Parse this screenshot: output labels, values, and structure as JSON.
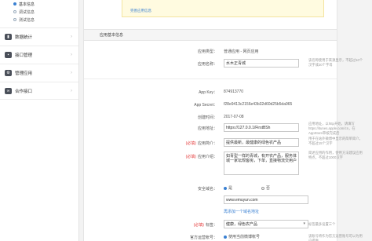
{
  "sidebar": {
    "sub_items": [
      {
        "label": "基本信息",
        "active": true
      },
      {
        "label": "调试信息",
        "active": false
      },
      {
        "label": "测试信息",
        "active": false
      }
    ],
    "groups": [
      {
        "label": "数据统计",
        "icon": "chart-icon"
      },
      {
        "label": "接口管理",
        "icon": "plug-icon"
      },
      {
        "label": "管理应用",
        "icon": "gear-icon"
      },
      {
        "label": "合作接口",
        "icon": "link-icon"
      }
    ]
  },
  "notice": {
    "text": "完善应用信息"
  },
  "section": {
    "title": "应用基本信息"
  },
  "form": {
    "app_type_label": "应用类型：",
    "app_type_value": "普通应用 - 网页应用",
    "app_name_label": "应用名称：",
    "app_name_value": "水木正青城",
    "app_name_hint": "该名称使用于来源显示，不超过10个汉字或20个字母",
    "app_key_label": "App Key：",
    "app_key_value": "874913770",
    "app_secret_label": "App Secret：",
    "app_secret_value": "f28e9413c2156e43b32d60d25b5da965",
    "created_label": "创建时间：",
    "created_value": "2017-07-08",
    "app_url_label": "应用地址：",
    "app_url_value": "https://127.0.0.1/FirstBSh",
    "app_url_hint": "应用地址，以http开始，请填写https://itunes.apple.com/cn，在AppStore审核完成后",
    "intro_label": "应用简介：",
    "intro_value": "提供最新，最健康的绿色农产品",
    "intro_hint": "用于在站外微博中显示的简单简介，不超过15个汉字",
    "desc_label": "应用介绍：",
    "desc_value": "如青型一样的青城，有开农产品，服务体城一家坛规客房，下单，直接物流交用户",
    "desc_hint": "简述应用的作用，使用方法建议应用特点，不超过1000汉字",
    "security_label": "安全域名：",
    "security_options": [
      "是",
      "否"
    ],
    "domain_value": "www.emuyun.com",
    "add_domain_link": "再添加一个域名地址",
    "tag_label": "标签：",
    "tag_value": "健康，绿色农产品",
    "tag_hint": "标签最多设置三个",
    "official_label": "官方运营帐号：",
    "official_value": "使用当前微博帐号",
    "official_hint": "该账号将作为官方运营账号可以为用户提供"
  }
}
